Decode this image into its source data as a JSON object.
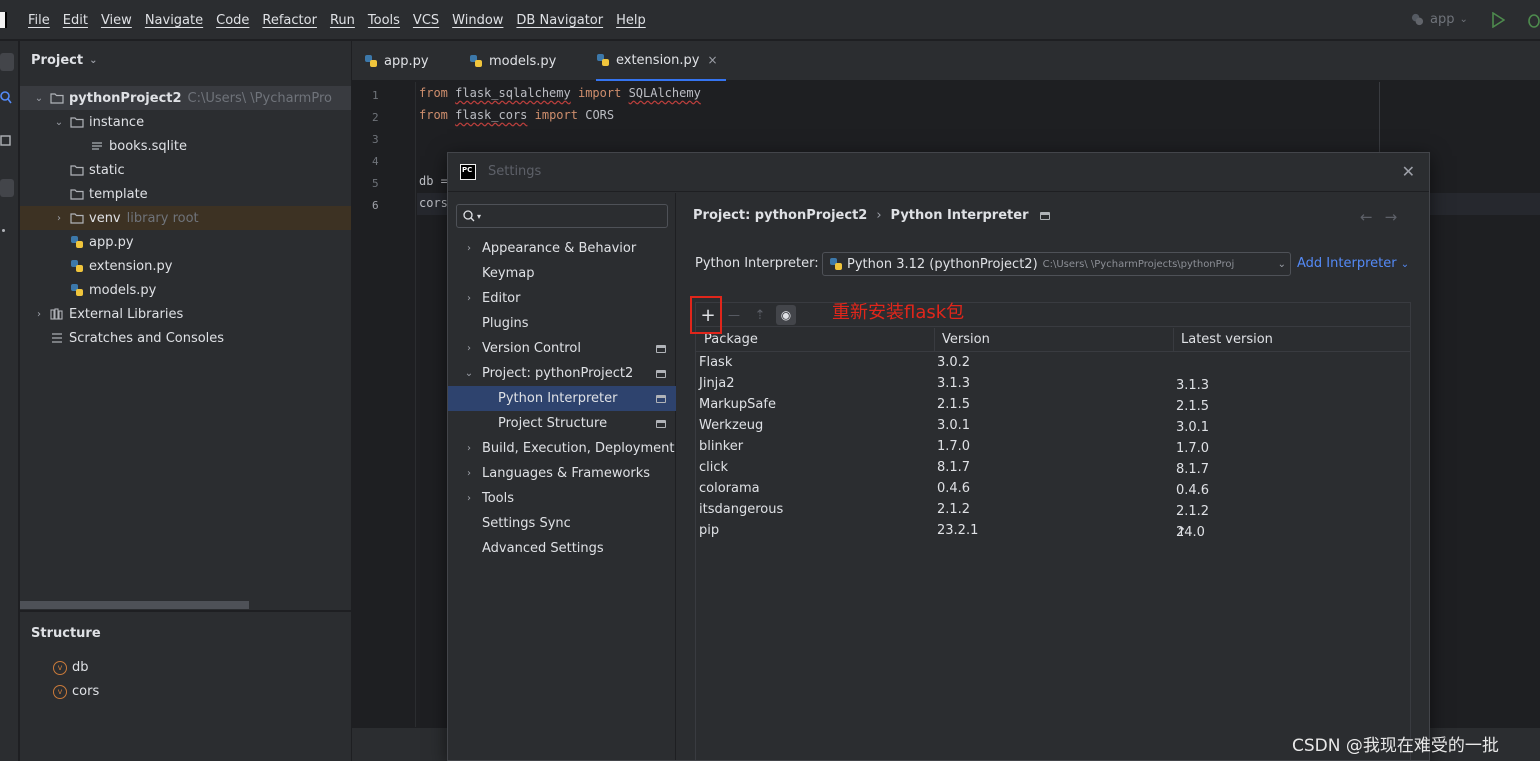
{
  "menu": {
    "items": [
      "File",
      "Edit",
      "View",
      "Navigate",
      "Code",
      "Refactor",
      "Run",
      "Tools",
      "VCS",
      "Window",
      "DB Navigator",
      "Help"
    ],
    "run_config": "app"
  },
  "project": {
    "title": "Project",
    "tree": [
      {
        "name": "pythonProject2",
        "hint": "C:\\Users\\          \\PycharmPro",
        "icon": "folder-icon",
        "indent": 0,
        "expanded": true,
        "arrow": "⌄"
      },
      {
        "name": "instance",
        "hint": "",
        "icon": "folder-icon",
        "indent": 1,
        "arrow": "⌄"
      },
      {
        "name": "books.sqlite",
        "hint": "",
        "icon": "text-file-icon",
        "indent": 2,
        "arrow": ""
      },
      {
        "name": "static",
        "hint": "",
        "icon": "folder-icon",
        "indent": 1,
        "arrow": ""
      },
      {
        "name": "template",
        "hint": "",
        "icon": "folder-icon",
        "indent": 1,
        "arrow": ""
      },
      {
        "name": "venv",
        "hint": "library root",
        "icon": "folder-icon",
        "indent": 1,
        "arrow": "›"
      },
      {
        "name": "app.py",
        "hint": "",
        "icon": "python-file-icon",
        "indent": 1,
        "arrow": ""
      },
      {
        "name": "extension.py",
        "hint": "",
        "icon": "python-file-icon",
        "indent": 1,
        "arrow": ""
      },
      {
        "name": "models.py",
        "hint": "",
        "icon": "python-file-icon",
        "indent": 1,
        "arrow": ""
      },
      {
        "name": "External Libraries",
        "hint": "",
        "icon": "library-icon",
        "indent": 0,
        "arrow": "›"
      },
      {
        "name": "Scratches and Consoles",
        "hint": "",
        "icon": "scratches-icon",
        "indent": 0,
        "arrow": ""
      }
    ]
  },
  "structure": {
    "title": "Structure",
    "items": [
      "db",
      "cors"
    ]
  },
  "editor": {
    "tabs": [
      {
        "label": "app.py",
        "active": false
      },
      {
        "label": "models.py",
        "active": false
      },
      {
        "label": "extension.py",
        "active": true,
        "close": "×"
      }
    ],
    "line_numbers": [
      "1",
      "2",
      "3",
      "4",
      "5",
      "6"
    ],
    "lines": {
      "l1": {
        "kw1": "from",
        "mod": "flask_sqlalchemy",
        "kw2": "import",
        "name": "SQLAlchemy"
      },
      "l2": {
        "kw1": "from",
        "mod": "flask_cors",
        "kw2": "import",
        "name": "CORS"
      },
      "l5": "db =",
      "l6": "cors"
    }
  },
  "settings": {
    "title": "Settings",
    "close": "✕",
    "nav": [
      {
        "label": "Appearance & Behavior",
        "arrow": "›",
        "indent": 0,
        "badge": false,
        "selected": false
      },
      {
        "label": "Keymap",
        "arrow": "",
        "indent": 0,
        "badge": false,
        "selected": false
      },
      {
        "label": "Editor",
        "arrow": "›",
        "indent": 0,
        "badge": false,
        "selected": false
      },
      {
        "label": "Plugins",
        "arrow": "",
        "indent": 0,
        "badge": false,
        "selected": false
      },
      {
        "label": "Version Control",
        "arrow": "›",
        "indent": 0,
        "badge": true,
        "selected": false
      },
      {
        "label": "Project: pythonProject2",
        "arrow": "⌄",
        "indent": 0,
        "badge": true,
        "selected": false
      },
      {
        "label": "Python Interpreter",
        "arrow": "",
        "indent": 1,
        "badge": true,
        "selected": true
      },
      {
        "label": "Project Structure",
        "arrow": "",
        "indent": 1,
        "badge": true,
        "selected": false
      },
      {
        "label": "Build, Execution, Deployment",
        "arrow": "›",
        "indent": 0,
        "badge": false,
        "selected": false
      },
      {
        "label": "Languages & Frameworks",
        "arrow": "›",
        "indent": 0,
        "badge": false,
        "selected": false
      },
      {
        "label": "Tools",
        "arrow": "›",
        "indent": 0,
        "badge": false,
        "selected": false
      },
      {
        "label": "Settings Sync",
        "arrow": "",
        "indent": 0,
        "badge": false,
        "selected": false
      },
      {
        "label": "Advanced Settings",
        "arrow": "",
        "indent": 0,
        "badge": false,
        "selected": false
      }
    ],
    "breadcrumb": {
      "parent": "Project: pythonProject2",
      "sep": "›",
      "current": "Python Interpreter"
    },
    "nav_arrows": "←→",
    "interpreter_label": "Python Interpreter:",
    "interpreter_value": "Python 3.12 (pythonProject2)",
    "interpreter_path": "C:\\Users\\        \\PycharmProjects\\pythonProj",
    "add_interpreter": "Add Interpreter",
    "toolbar": {
      "add": "+",
      "remove": "—",
      "upgrade": "⇡",
      "show": "◉"
    },
    "annotation": "重新安装flask包",
    "columns": [
      "Package",
      "Version",
      "Latest version"
    ],
    "packages": [
      {
        "name": "Flask",
        "version": "3.0.2",
        "latest": "",
        "upgrade": false
      },
      {
        "name": "Jinja2",
        "version": "3.1.3",
        "latest": "3.1.3",
        "upgrade": false
      },
      {
        "name": "MarkupSafe",
        "version": "2.1.5",
        "latest": "2.1.5",
        "upgrade": false
      },
      {
        "name": "Werkzeug",
        "version": "3.0.1",
        "latest": "3.0.1",
        "upgrade": false
      },
      {
        "name": "blinker",
        "version": "1.7.0",
        "latest": "1.7.0",
        "upgrade": false
      },
      {
        "name": "click",
        "version": "8.1.7",
        "latest": "8.1.7",
        "upgrade": false
      },
      {
        "name": "colorama",
        "version": "0.4.6",
        "latest": "0.4.6",
        "upgrade": false
      },
      {
        "name": "itsdangerous",
        "version": "2.1.2",
        "latest": "2.1.2",
        "upgrade": false
      },
      {
        "name": "pip",
        "version": "23.2.1",
        "latest": "24.0",
        "upgrade": true
      }
    ]
  },
  "watermark": "CSDN @我现在难受的一批",
  "colors": {
    "accent": "#3574f0",
    "selection": "#2e436e",
    "annotation": "#e0261b",
    "link": "#548af7"
  }
}
